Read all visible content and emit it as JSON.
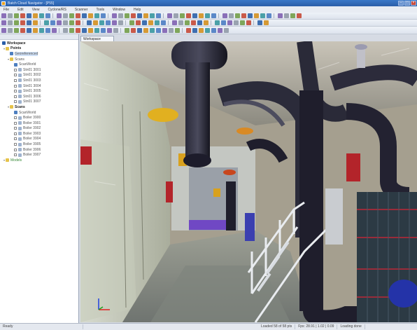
{
  "window": {
    "title": "Batch Cloud Navigator - [P55]"
  },
  "menu": [
    "File",
    "Edit",
    "View",
    "Cyclone/RS",
    "Scanner",
    "Tools",
    "Window",
    "Help"
  ],
  "viewport_tab": "Workspace",
  "tree": {
    "root": "Workspace",
    "items": [
      {
        "label": "Points",
        "level": 1,
        "kind": "folder",
        "style": "bold"
      },
      {
        "label": "Georeferenced",
        "level": 2,
        "kind": "scan",
        "style": "selected"
      },
      {
        "label": "Scans",
        "level": 2,
        "kind": "folder",
        "style": "normal"
      },
      {
        "label": "ScanWorld",
        "level": 3,
        "kind": "scan",
        "style": "normal"
      },
      {
        "label": "Stn01 3001",
        "level": 3,
        "kind": "station",
        "style": "normal"
      },
      {
        "label": "Stn01 3002",
        "level": 3,
        "kind": "station",
        "style": "normal"
      },
      {
        "label": "Stn01 3003",
        "level": 3,
        "kind": "station",
        "style": "normal"
      },
      {
        "label": "Stn01 3004",
        "level": 3,
        "kind": "station",
        "style": "normal"
      },
      {
        "label": "Stn01 3005",
        "level": 3,
        "kind": "station",
        "style": "normal"
      },
      {
        "label": "Stn01 3006",
        "level": 3,
        "kind": "station",
        "style": "normal"
      },
      {
        "label": "Stn01 3007",
        "level": 3,
        "kind": "station",
        "style": "normal"
      },
      {
        "label": "Scans",
        "level": 2,
        "kind": "folder",
        "style": "bold"
      },
      {
        "label": "ScanWorld",
        "level": 3,
        "kind": "scan",
        "style": "normal"
      },
      {
        "label": "Boiler 3900",
        "level": 3,
        "kind": "station",
        "style": "normal"
      },
      {
        "label": "Boiler 3901",
        "level": 3,
        "kind": "station",
        "style": "normal"
      },
      {
        "label": "Boiler 3902",
        "level": 3,
        "kind": "station",
        "style": "normal"
      },
      {
        "label": "Boiler 3903",
        "level": 3,
        "kind": "station",
        "style": "normal"
      },
      {
        "label": "Boiler 3904",
        "level": 3,
        "kind": "station",
        "style": "normal"
      },
      {
        "label": "Boiler 3905",
        "level": 3,
        "kind": "station",
        "style": "normal"
      },
      {
        "label": "Boiler 3906",
        "level": 3,
        "kind": "station",
        "style": "normal"
      },
      {
        "label": "Boiler 3907",
        "level": 3,
        "kind": "station",
        "style": "normal"
      },
      {
        "label": "Models",
        "level": 1,
        "kind": "folder",
        "style": "green"
      }
    ]
  },
  "status": {
    "left": "Ready",
    "mid": "Loaded 58 of 58 pts",
    "fps": "Fps: 28.91 | 1.02 | 0.09",
    "right": "Loading done"
  },
  "colors": {
    "accent": "#2a5ea8",
    "pipe_dark": "#1d1c2b",
    "stair_white": "#e9ecf0",
    "valve_red": "#b3242a",
    "valve_yellow": "#e1b020",
    "floor_gray": "#8a8f8d"
  }
}
